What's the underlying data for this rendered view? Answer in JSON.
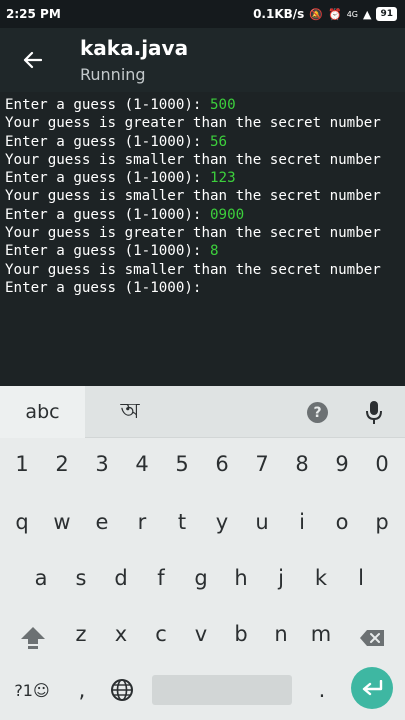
{
  "status_bar": {
    "time": "2:25 PM",
    "net_speed": "0.1KB/s",
    "battery": "91",
    "network_label": "4G"
  },
  "app_bar": {
    "title": "kaka.java",
    "subtitle": "Running"
  },
  "console": {
    "lines": [
      {
        "text": "Enter a guess (1-1000): ",
        "input": "500"
      },
      {
        "text": "Your guess is greater than the secret number",
        "input": ""
      },
      {
        "text": "Enter a guess (1-1000): ",
        "input": "56"
      },
      {
        "text": "Your guess is smaller than the secret number",
        "input": ""
      },
      {
        "text": "Enter a guess (1-1000): ",
        "input": "123"
      },
      {
        "text": "Your guess is smaller than the secret number",
        "input": ""
      },
      {
        "text": "Enter a guess (1-1000): ",
        "input": "0900"
      },
      {
        "text": "Your guess is greater than the secret number",
        "input": ""
      },
      {
        "text": "Enter a guess (1-1000): ",
        "input": "8"
      },
      {
        "text": "Your guess is smaller than the secret number",
        "input": ""
      },
      {
        "text": "Enter a guess (1-1000): ",
        "input": ""
      }
    ],
    "input_color": "#3ccf3c"
  },
  "keyboard": {
    "lang_primary": "abc",
    "lang_secondary": "অ",
    "help_label": "?",
    "row_numbers": [
      "1",
      "2",
      "3",
      "4",
      "5",
      "6",
      "7",
      "8",
      "9",
      "0"
    ],
    "row_1": [
      "q",
      "w",
      "e",
      "r",
      "t",
      "y",
      "u",
      "i",
      "o",
      "p"
    ],
    "row_2": [
      "a",
      "s",
      "d",
      "f",
      "g",
      "h",
      "j",
      "k",
      "l"
    ],
    "row_3": [
      "z",
      "x",
      "c",
      "v",
      "b",
      "n",
      "m"
    ],
    "symbols_label": "?1☺",
    "comma_label": ",",
    "period_label": ".",
    "enter_color": "#3eb7a2"
  }
}
